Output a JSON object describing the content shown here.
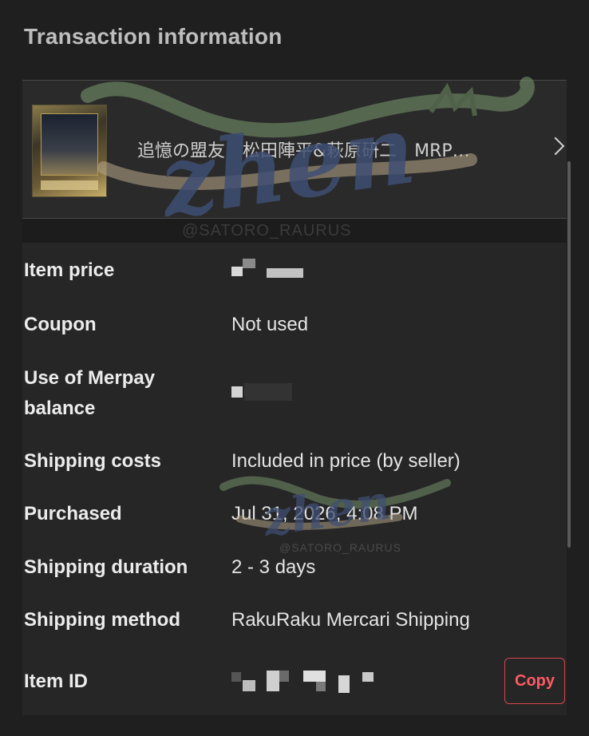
{
  "section_title": "Transaction information",
  "item": {
    "title": "追憶の盟友　松田陣平&萩原研二　MRP…",
    "thumbnail_icon": "trading-card-thumbnail",
    "chevron_icon": "chevron-right-icon"
  },
  "watermark": {
    "text": "zhen",
    "handle": "@SATORO_RAURUS"
  },
  "rows": [
    {
      "label": "Item price",
      "value": ""
    },
    {
      "label": "Coupon",
      "value": "Not used"
    },
    {
      "label_line1": "Use of Merpay",
      "label_line2": "balance",
      "value": ""
    },
    {
      "label": "Shipping costs",
      "value": "Included in price (by seller)"
    },
    {
      "label": "Purchased",
      "value": "Jul 31, 2026, 4:08 PM"
    },
    {
      "label": "Shipping duration",
      "value": "2 - 3 days"
    },
    {
      "label": "Shipping method",
      "value": "RakuRaku Mercari Shipping"
    },
    {
      "label": "Item ID",
      "value": ""
    }
  ],
  "copy_button": {
    "label": "Copy"
  },
  "colors": {
    "background": "#1f1f1f",
    "panel": "#262626",
    "accent_red": "#ff5a63"
  }
}
